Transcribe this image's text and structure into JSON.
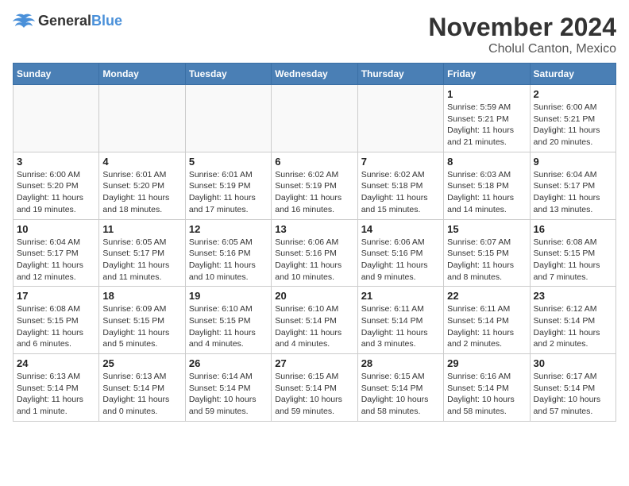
{
  "header": {
    "logo_general": "General",
    "logo_blue": "Blue",
    "month_title": "November 2024",
    "location": "Cholul Canton, Mexico"
  },
  "calendar": {
    "weekdays": [
      "Sunday",
      "Monday",
      "Tuesday",
      "Wednesday",
      "Thursday",
      "Friday",
      "Saturday"
    ],
    "weeks": [
      [
        {
          "day": "",
          "info": ""
        },
        {
          "day": "",
          "info": ""
        },
        {
          "day": "",
          "info": ""
        },
        {
          "day": "",
          "info": ""
        },
        {
          "day": "",
          "info": ""
        },
        {
          "day": "1",
          "info": "Sunrise: 5:59 AM\nSunset: 5:21 PM\nDaylight: 11 hours and 21 minutes."
        },
        {
          "day": "2",
          "info": "Sunrise: 6:00 AM\nSunset: 5:21 PM\nDaylight: 11 hours and 20 minutes."
        }
      ],
      [
        {
          "day": "3",
          "info": "Sunrise: 6:00 AM\nSunset: 5:20 PM\nDaylight: 11 hours and 19 minutes."
        },
        {
          "day": "4",
          "info": "Sunrise: 6:01 AM\nSunset: 5:20 PM\nDaylight: 11 hours and 18 minutes."
        },
        {
          "day": "5",
          "info": "Sunrise: 6:01 AM\nSunset: 5:19 PM\nDaylight: 11 hours and 17 minutes."
        },
        {
          "day": "6",
          "info": "Sunrise: 6:02 AM\nSunset: 5:19 PM\nDaylight: 11 hours and 16 minutes."
        },
        {
          "day": "7",
          "info": "Sunrise: 6:02 AM\nSunset: 5:18 PM\nDaylight: 11 hours and 15 minutes."
        },
        {
          "day": "8",
          "info": "Sunrise: 6:03 AM\nSunset: 5:18 PM\nDaylight: 11 hours and 14 minutes."
        },
        {
          "day": "9",
          "info": "Sunrise: 6:04 AM\nSunset: 5:17 PM\nDaylight: 11 hours and 13 minutes."
        }
      ],
      [
        {
          "day": "10",
          "info": "Sunrise: 6:04 AM\nSunset: 5:17 PM\nDaylight: 11 hours and 12 minutes."
        },
        {
          "day": "11",
          "info": "Sunrise: 6:05 AM\nSunset: 5:17 PM\nDaylight: 11 hours and 11 minutes."
        },
        {
          "day": "12",
          "info": "Sunrise: 6:05 AM\nSunset: 5:16 PM\nDaylight: 11 hours and 10 minutes."
        },
        {
          "day": "13",
          "info": "Sunrise: 6:06 AM\nSunset: 5:16 PM\nDaylight: 11 hours and 10 minutes."
        },
        {
          "day": "14",
          "info": "Sunrise: 6:06 AM\nSunset: 5:16 PM\nDaylight: 11 hours and 9 minutes."
        },
        {
          "day": "15",
          "info": "Sunrise: 6:07 AM\nSunset: 5:15 PM\nDaylight: 11 hours and 8 minutes."
        },
        {
          "day": "16",
          "info": "Sunrise: 6:08 AM\nSunset: 5:15 PM\nDaylight: 11 hours and 7 minutes."
        }
      ],
      [
        {
          "day": "17",
          "info": "Sunrise: 6:08 AM\nSunset: 5:15 PM\nDaylight: 11 hours and 6 minutes."
        },
        {
          "day": "18",
          "info": "Sunrise: 6:09 AM\nSunset: 5:15 PM\nDaylight: 11 hours and 5 minutes."
        },
        {
          "day": "19",
          "info": "Sunrise: 6:10 AM\nSunset: 5:15 PM\nDaylight: 11 hours and 4 minutes."
        },
        {
          "day": "20",
          "info": "Sunrise: 6:10 AM\nSunset: 5:14 PM\nDaylight: 11 hours and 4 minutes."
        },
        {
          "day": "21",
          "info": "Sunrise: 6:11 AM\nSunset: 5:14 PM\nDaylight: 11 hours and 3 minutes."
        },
        {
          "day": "22",
          "info": "Sunrise: 6:11 AM\nSunset: 5:14 PM\nDaylight: 11 hours and 2 minutes."
        },
        {
          "day": "23",
          "info": "Sunrise: 6:12 AM\nSunset: 5:14 PM\nDaylight: 11 hours and 2 minutes."
        }
      ],
      [
        {
          "day": "24",
          "info": "Sunrise: 6:13 AM\nSunset: 5:14 PM\nDaylight: 11 hours and 1 minute."
        },
        {
          "day": "25",
          "info": "Sunrise: 6:13 AM\nSunset: 5:14 PM\nDaylight: 11 hours and 0 minutes."
        },
        {
          "day": "26",
          "info": "Sunrise: 6:14 AM\nSunset: 5:14 PM\nDaylight: 10 hours and 59 minutes."
        },
        {
          "day": "27",
          "info": "Sunrise: 6:15 AM\nSunset: 5:14 PM\nDaylight: 10 hours and 59 minutes."
        },
        {
          "day": "28",
          "info": "Sunrise: 6:15 AM\nSunset: 5:14 PM\nDaylight: 10 hours and 58 minutes."
        },
        {
          "day": "29",
          "info": "Sunrise: 6:16 AM\nSunset: 5:14 PM\nDaylight: 10 hours and 58 minutes."
        },
        {
          "day": "30",
          "info": "Sunrise: 6:17 AM\nSunset: 5:14 PM\nDaylight: 10 hours and 57 minutes."
        }
      ]
    ]
  }
}
